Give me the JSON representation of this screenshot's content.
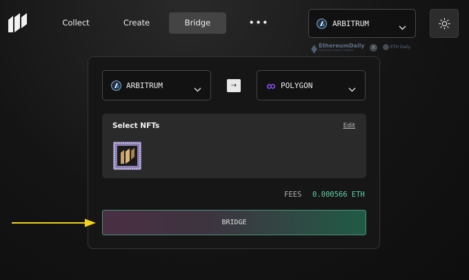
{
  "header": {
    "logo_icon": "brand-logo",
    "nav": [
      {
        "label": "Collect"
      },
      {
        "label": "Create"
      },
      {
        "label": "Bridge",
        "active": true
      }
    ],
    "more_icon": "ellipsis-icon",
    "network": {
      "label": "ARBITRUM",
      "icon": "arbitrum-icon"
    },
    "theme_icon": "sun-icon"
  },
  "watermark": {
    "name": "EthereumDaily",
    "sub": "Ethereum & Layer 2 Updates",
    "x_label": "X",
    "eth_label": "ETH Daily"
  },
  "bridge": {
    "from": {
      "label": "ARBITRUM",
      "icon": "arbitrum-icon"
    },
    "to": {
      "label": "POLYGON",
      "icon": "polygon-icon"
    },
    "arrow": "→",
    "nft_section": {
      "title": "Select NFTs",
      "edit_label": "Edit"
    },
    "fees_label": "FEES",
    "fees_value": "0.000566 ETH",
    "button_label": "BRIDGE"
  },
  "colors": {
    "accent_green": "#5fd3a6",
    "annotation_arrow": "#f2d21b"
  }
}
